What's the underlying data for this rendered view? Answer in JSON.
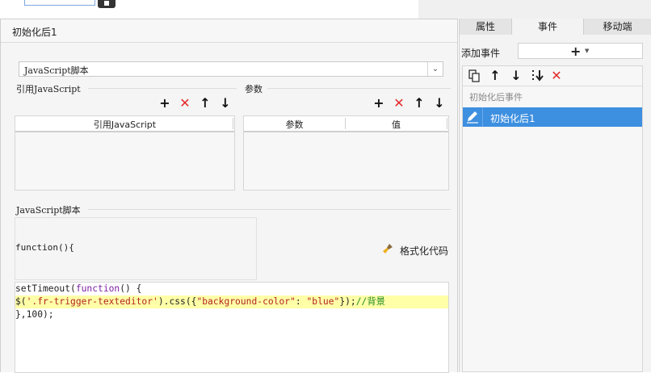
{
  "dialog": {
    "title": "初始化后1",
    "script_type_select": {
      "value": "JavaScript脚本"
    },
    "ref_js": {
      "label": "引用JavaScript",
      "column_header": "引用JavaScript",
      "rows": []
    },
    "params": {
      "label": "参数",
      "columns": [
        "参数",
        "值"
      ],
      "rows": []
    },
    "script": {
      "label": "JavaScript脚本",
      "function_header": "function(){",
      "format_button": "格式化代码",
      "code_lines": [
        {
          "parts": [
            [
              "plain",
              "setTimeout("
            ],
            [
              "kw",
              "function"
            ],
            [
              "plain",
              "() {"
            ]
          ]
        },
        {
          "parts": [
            [
              "plain",
              "$("
            ],
            [
              "str",
              "'.fr-trigger-texteditor'"
            ],
            [
              "plain",
              ").css({"
            ],
            [
              "str",
              "\"background-color\""
            ],
            [
              "plain",
              ": "
            ],
            [
              "str",
              "\"blue\""
            ],
            [
              "plain",
              "});"
            ],
            [
              "cm",
              "//背景"
            ]
          ]
        },
        {
          "parts": [
            [
              "plain",
              "},100);"
            ]
          ]
        }
      ]
    }
  },
  "right_panel": {
    "tabs": [
      "属性",
      "事件",
      "移动端"
    ],
    "active_tab": "事件",
    "add_event_label": "添加事件",
    "event_group": "初始化后事件",
    "events": [
      "初始化后1"
    ]
  },
  "colors": {
    "selection": "#3d8fe0",
    "highlight_line": "#ffffa8",
    "delete_red": "#e12b2b"
  }
}
